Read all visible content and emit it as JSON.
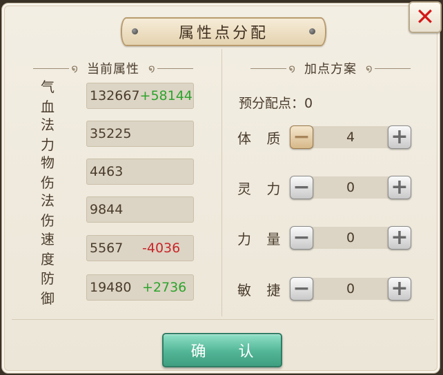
{
  "dialog": {
    "title": "属性点分配",
    "close_label": "✕",
    "confirm_label": "确 认"
  },
  "current": {
    "header": "当前属性",
    "stats": [
      {
        "name": "气 血",
        "value": "132667",
        "bonus": "+58144"
      },
      {
        "name": "法 力",
        "value": "35225",
        "bonus": ""
      },
      {
        "name": "物 伤",
        "value": "4463",
        "bonus": ""
      },
      {
        "name": "法 伤",
        "value": "9844",
        "bonus": ""
      },
      {
        "name": "速 度",
        "value": "5567",
        "bonus": "-4036"
      },
      {
        "name": "防 御",
        "value": "19480",
        "bonus": "+2736"
      }
    ]
  },
  "plan": {
    "header": "加点方案",
    "remaining_label": "预分配点：0",
    "rows": [
      {
        "name": "体 质",
        "value": "4"
      },
      {
        "name": "灵 力",
        "value": "0"
      },
      {
        "name": "力 量",
        "value": "0"
      },
      {
        "name": "敏 捷",
        "value": "0"
      }
    ],
    "minus_symbol": "−",
    "plus_symbol": "+"
  },
  "colors": {
    "bonus_positive": "#2da32d",
    "bonus_negative": "#c8262a",
    "confirm_button": "#52b596",
    "close_x": "#d51818"
  }
}
